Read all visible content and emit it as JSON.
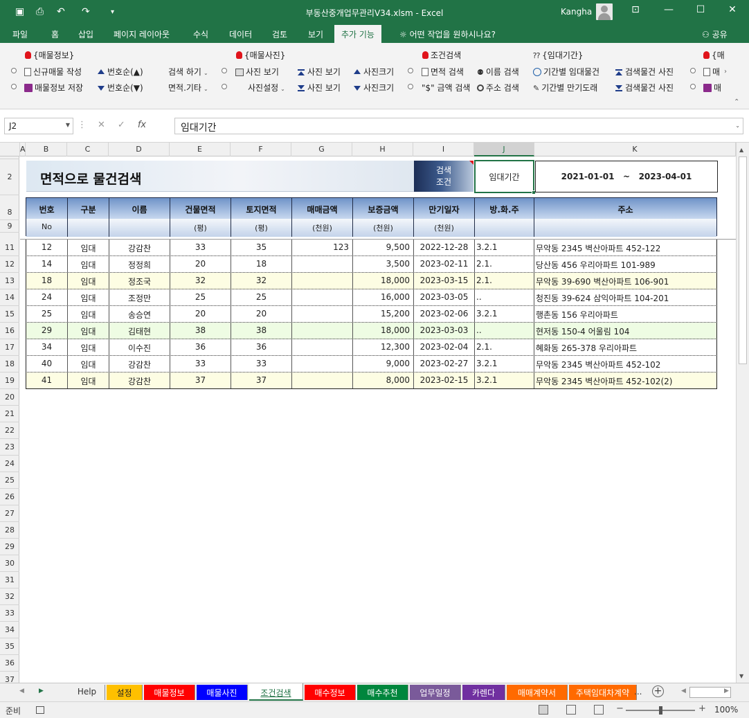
{
  "window": {
    "title": "부동산중개업무관리V34.xlsm  -  Excel",
    "user": "Kangha"
  },
  "ribbon_tabs": [
    "파일",
    "홈",
    "삽입",
    "페이지 레이아웃",
    "수식",
    "데이터",
    "검토",
    "보기",
    "추가 기능"
  ],
  "active_tab": "추가 기능",
  "tell_me": "어떤 작업을 원하시나요?",
  "share": "공유",
  "ribbon": {
    "group1": {
      "title": "{매물정보}",
      "btn1": "신규매물 작성",
      "btn2": "매물정보 저장",
      "sort_asc": "번호순(▲)",
      "sort_desc": "번호순(▼)",
      "search": "검색 하기",
      "area": "면적.기타"
    },
    "group2": {
      "title": "{매물사진}",
      "btn1": "사진 보기",
      "btn2": "사진설정",
      "photo_up": "사진 보기",
      "photo_dn": "사진 보기",
      "size_up": "사진크기",
      "size_dn": "사진크기"
    },
    "group3": {
      "title": "조건검색",
      "area_search": "면적 검색",
      "amount_search": "\"$\" 금액 검색",
      "name_search": "이름 검색",
      "addr_search": "주소 검색"
    },
    "group4": {
      "title": "{임대기간}",
      "period_rent": "기간별 임대물건",
      "period_expire": "기간별 만기도래",
      "photo1": "검색물건 사진",
      "photo2": "검색물건 사진"
    },
    "group5": {
      "title": "{매",
      "b1": "매",
      "b2": "매"
    }
  },
  "namebox": "J2",
  "formula": "임대기간",
  "columns": [
    "A",
    "B",
    "C",
    "D",
    "E",
    "F",
    "G",
    "H",
    "I",
    "J",
    "K"
  ],
  "selected_column": "J",
  "rows": [
    "1",
    "2",
    "8",
    "9",
    "11",
    "12",
    "13",
    "14",
    "15",
    "16",
    "17",
    "18",
    "19",
    "20",
    "21",
    "22",
    "23",
    "24",
    "25",
    "26",
    "27",
    "28",
    "29",
    "30",
    "31",
    "32",
    "33",
    "34",
    "35",
    "36",
    "37"
  ],
  "sheet": {
    "title": "면적으로 물건검색",
    "condition_label_1": "검색",
    "condition_label_2": "조건",
    "condition_value": "임대기간",
    "date_from": "2021-01-01",
    "date_sep": "~",
    "date_to": "2023-04-01"
  },
  "headers": [
    {
      "top": "번호",
      "bottom": "No"
    },
    {
      "top": "구분",
      "bottom": ""
    },
    {
      "top": "이름",
      "bottom": ""
    },
    {
      "top": "건물면적",
      "bottom": "(평)"
    },
    {
      "top": "토지면적",
      "bottom": "(평)"
    },
    {
      "top": "매매금액",
      "bottom": "(천원)"
    },
    {
      "top": "보증금액",
      "bottom": "(천원)"
    },
    {
      "top": "만기일자",
      "bottom": "(천원)"
    },
    {
      "top": "방.화.주",
      "bottom": ""
    },
    {
      "top": "주소",
      "bottom": ""
    }
  ],
  "table": [
    {
      "no": "12",
      "type": "임대",
      "name": "강감찬",
      "bldg": "33",
      "land": "35",
      "sale": "123",
      "deposit": "9,500",
      "expire": "2022-12-28",
      "rooms": "3.2.1",
      "addr": "무악동 2345 벽산아파트 452-122"
    },
    {
      "no": "14",
      "type": "임대",
      "name": "정정희",
      "bldg": "20",
      "land": "18",
      "sale": "",
      "deposit": "3,500",
      "expire": "2023-02-11",
      "rooms": "2.1.",
      "addr": "당산동 456 우리아파트 101-989"
    },
    {
      "no": "18",
      "type": "임대",
      "name": "정조국",
      "bldg": "32",
      "land": "32",
      "sale": "",
      "deposit": "18,000",
      "expire": "2023-03-15",
      "rooms": "2.1.",
      "addr": "무악동 39-690 벽산아파트 106-901"
    },
    {
      "no": "24",
      "type": "임대",
      "name": "조정만",
      "bldg": "25",
      "land": "25",
      "sale": "",
      "deposit": "16,000",
      "expire": "2023-03-05",
      "rooms": "..",
      "addr": "청진동 39-624 삼익아파트 104-201"
    },
    {
      "no": "25",
      "type": "임대",
      "name": "송승연",
      "bldg": "20",
      "land": "20",
      "sale": "",
      "deposit": "15,200",
      "expire": "2023-02-06",
      "rooms": "3.2.1",
      "addr": "행촌동 156 우리아파트"
    },
    {
      "no": "29",
      "type": "임대",
      "name": "김태현",
      "bldg": "38",
      "land": "38",
      "sale": "",
      "deposit": "18,000",
      "expire": "2023-03-03",
      "rooms": "..",
      "addr": "현저동 150-4 어울림 104"
    },
    {
      "no": "34",
      "type": "임대",
      "name": "이수진",
      "bldg": "36",
      "land": "36",
      "sale": "",
      "deposit": "12,300",
      "expire": "2023-02-04",
      "rooms": "2.1.",
      "addr": "혜화동 265-378 우리아파트"
    },
    {
      "no": "40",
      "type": "임대",
      "name": "강감찬",
      "bldg": "33",
      "land": "33",
      "sale": "",
      "deposit": "9,000",
      "expire": "2023-02-27",
      "rooms": "3.2.1",
      "addr": "무악동 2345 벽산아파트 452-102"
    },
    {
      "no": "41",
      "type": "임대",
      "name": "강감찬",
      "bldg": "37",
      "land": "37",
      "sale": "",
      "deposit": "8,000",
      "expire": "2023-02-15",
      "rooms": "3.2.1",
      "addr": "무악동 2345 벽산아파트 452-102(2)"
    }
  ],
  "sheet_tabs": [
    {
      "label": "Help",
      "color": "#f0f0f0"
    },
    {
      "label": "설정",
      "color": "#ffc000"
    },
    {
      "label": "매물정보",
      "color": "#ff0000"
    },
    {
      "label": "매물사진",
      "color": "#0000ff"
    },
    {
      "label": "조건검색",
      "color": "#ffffff"
    },
    {
      "label": "매수정보",
      "color": "#ff0000"
    },
    {
      "label": "매수추천",
      "color": "#00863d"
    },
    {
      "label": "업무일정",
      "color": "#7a5a9a"
    },
    {
      "label": "카렌다",
      "color": "#7030a0"
    },
    {
      "label": "매매계약서",
      "color": "#ff6a00"
    },
    {
      "label": "주택임대차계약",
      "color": "#ff6a00"
    }
  ],
  "active_sheet": "조건검색",
  "status": {
    "ready": "준비",
    "zoom": "100%"
  }
}
